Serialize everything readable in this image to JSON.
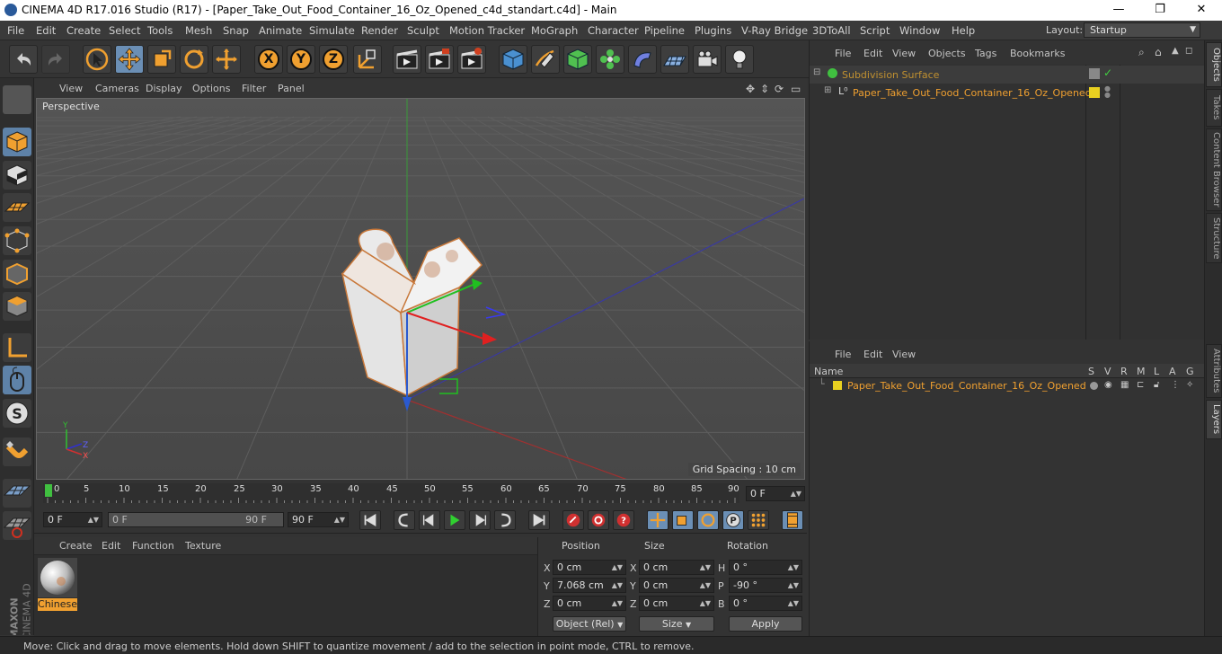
{
  "window": {
    "title": "CINEMA 4D R17.016 Studio (R17) - [Paper_Take_Out_Food_Container_16_Oz_Opened_c4d_standart.c4d] - Main",
    "minimize": "—",
    "maximize": "❐",
    "close": "✕"
  },
  "menubar": {
    "items": [
      "File",
      "Edit",
      "Create",
      "Select",
      "Tools",
      "Mesh",
      "Snap",
      "Animate",
      "Simulate",
      "Render",
      "Sculpt",
      "Motion Tracker",
      "MoGraph",
      "Character",
      "Pipeline",
      "Plugins",
      "V-Ray Bridge",
      "3DToAll",
      "Script",
      "Window",
      "Help"
    ],
    "layout_label": "Layout:",
    "layout_value": "Startup"
  },
  "toolbar": {
    "axis_x": "X",
    "axis_y": "Y",
    "axis_z": "Z"
  },
  "viewport": {
    "menu": [
      "View",
      "Cameras",
      "Display",
      "Options",
      "Filter",
      "Panel"
    ],
    "camera_label": "Perspective",
    "grid_spacing": "Grid Spacing : 10 cm",
    "axis_labels": {
      "x": "X",
      "y": "Y",
      "z": "Z"
    }
  },
  "timeline": {
    "ticks": [
      "0",
      "5",
      "10",
      "15",
      "20",
      "25",
      "30",
      "35",
      "40",
      "45",
      "50",
      "55",
      "60",
      "65",
      "70",
      "75",
      "80",
      "85",
      "90"
    ],
    "current_frame": "0 F"
  },
  "transport": {
    "start_frame": "0 F",
    "range_start": "0 F",
    "range_end": "90 F",
    "end_frame": "90 F"
  },
  "material": {
    "menu": [
      "Create",
      "Edit",
      "Function",
      "Texture"
    ],
    "name": "Chinese"
  },
  "coordinates": {
    "headers": {
      "position": "Position",
      "size": "Size",
      "rotation": "Rotation"
    },
    "rows": [
      {
        "axis": "X",
        "pos": "0 cm",
        "size_axis": "X",
        "size": "0 cm",
        "rot_axis": "H",
        "rot": "0 °"
      },
      {
        "axis": "Y",
        "pos": "7.068 cm",
        "size_axis": "Y",
        "size": "0 cm",
        "rot_axis": "P",
        "rot": "-90 °"
      },
      {
        "axis": "Z",
        "pos": "0 cm",
        "size_axis": "Z",
        "size": "0 cm",
        "rot_axis": "B",
        "rot": "0 °"
      }
    ],
    "mode": "Object (Rel)",
    "size_mode": "Size",
    "apply": "Apply"
  },
  "objects": {
    "menu": [
      "File",
      "Edit",
      "View",
      "Objects",
      "Tags",
      "Bookmarks"
    ],
    "items": [
      {
        "name": "Subdivision Surface"
      },
      {
        "name": "Paper_Take_Out_Food_Container_16_Oz_Opened"
      }
    ]
  },
  "layers": {
    "menu": [
      "File",
      "Edit",
      "View"
    ],
    "columns": [
      "Name",
      "S",
      "V",
      "R",
      "M",
      "L",
      "A",
      "G"
    ],
    "items": [
      {
        "name": "Paper_Take_Out_Food_Container_16_Oz_Opened"
      }
    ]
  },
  "sidetabs": [
    "Objects",
    "Takes",
    "Content Browser",
    "Structure",
    "Attributes",
    "Layers"
  ],
  "status": "Move: Click and drag to move elements. Hold down SHIFT to quantize movement / add to the selection in point mode, CTRL to remove.",
  "brand": {
    "maxon": "MAXON",
    "product": "CINEMA 4D"
  },
  "colors": {
    "accent": "#f0a030",
    "selected_tool": "#6b8fb5",
    "layer": "#e8d020"
  }
}
